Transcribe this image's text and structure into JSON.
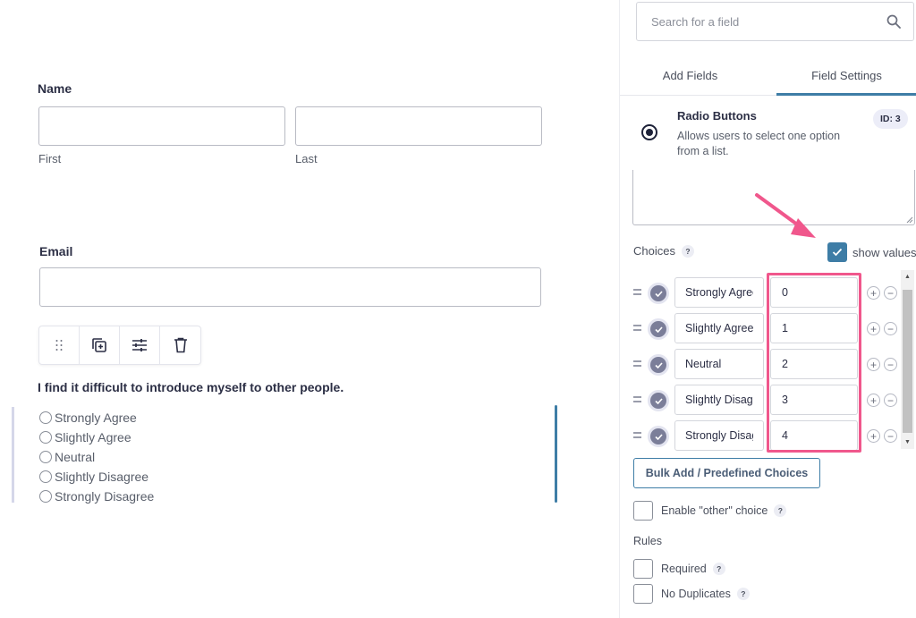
{
  "canvas": {
    "name_field": {
      "label": "Name",
      "first_value": "",
      "last_value": "",
      "first_sublabel": "First",
      "last_sublabel": "Last"
    },
    "email_field": {
      "label": "Email",
      "value": ""
    },
    "toolbar": {
      "icons": [
        "drag-handle-icon",
        "duplicate-icon",
        "settings-sliders-icon",
        "trash-icon"
      ]
    },
    "question": {
      "label": "I find it difficult to introduce myself to other people.",
      "options": [
        "Strongly Agree",
        "Slightly Agree",
        "Neutral",
        "Slightly Disagree",
        "Strongly Disagree"
      ]
    }
  },
  "sidebar": {
    "search": {
      "placeholder": "Search for a field",
      "value": ""
    },
    "tabs": [
      {
        "label": "Add Fields",
        "active": false
      },
      {
        "label": "Field Settings",
        "active": true
      }
    ],
    "field_info": {
      "title": "Radio Buttons",
      "description": "Allows users to select one option from a list.",
      "id_badge": "ID: 3"
    },
    "choices": {
      "label": "Choices",
      "help": "?",
      "show_values_label": "show values",
      "show_values_checked": true,
      "items": [
        {
          "label": "Strongly Agree",
          "value": "0"
        },
        {
          "label": "Slightly Agree",
          "value": "1"
        },
        {
          "label": "Neutral",
          "value": "2"
        },
        {
          "label": "Slightly Disagree",
          "value": "3"
        },
        {
          "label": "Strongly Disagree",
          "value": "4"
        }
      ]
    },
    "bulk_add_label": "Bulk Add / Predefined Choices",
    "enable_other": {
      "label": "Enable \"other\" choice",
      "help": "?",
      "checked": false
    },
    "rules": {
      "label": "Rules",
      "items": [
        {
          "label": "Required",
          "help": "?",
          "checked": false
        },
        {
          "label": "No Duplicates",
          "help": "?",
          "checked": false
        }
      ]
    }
  },
  "colors": {
    "accent": "#3e7da6",
    "annotation": "#f0578c",
    "text": "#2c2f45"
  }
}
